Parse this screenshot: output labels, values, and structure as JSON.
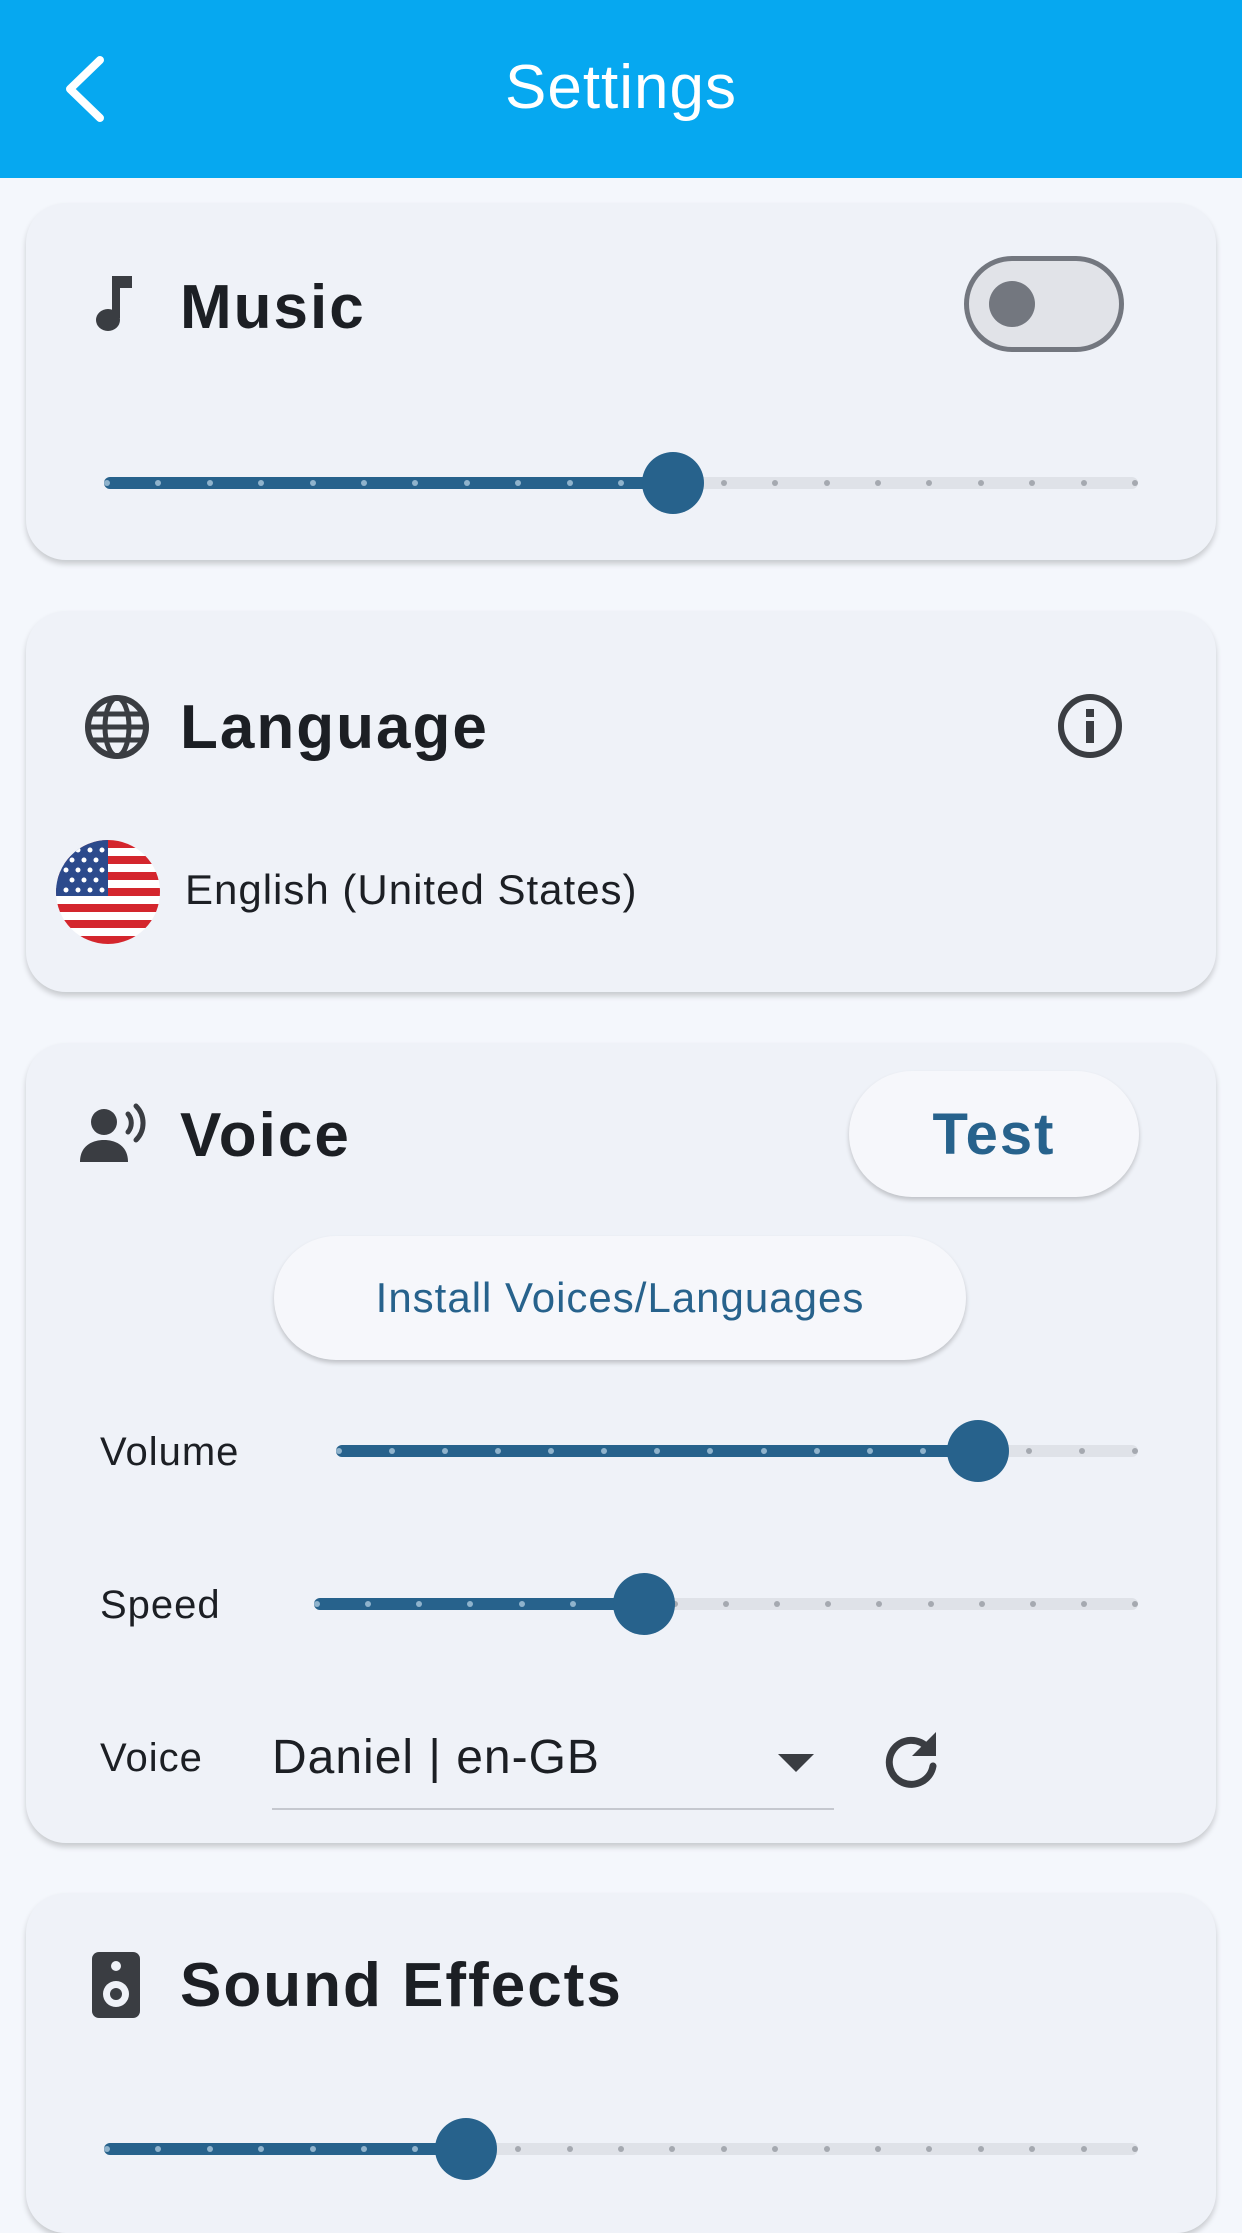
{
  "app_bar": {
    "title": "Settings",
    "back_icon": "chevron-left-icon"
  },
  "music": {
    "title": "Music",
    "icon": "music-note-icon",
    "toggle_on": false,
    "level": 0.55
  },
  "language": {
    "title": "Language",
    "icon": "globe-icon",
    "info_icon": "info-icon",
    "flag_icon": "us-flag-icon",
    "selected": "English (United States)"
  },
  "voice": {
    "title": "Voice",
    "icon": "speaking-person-icon",
    "test_label": "Test",
    "install_label": "Install Voices/Languages",
    "volume_label": "Volume",
    "volume_level": 0.8,
    "speed_label": "Speed",
    "speed_level": 0.4,
    "voice_label": "Voice",
    "voice_value": "Daniel | en-GB",
    "refresh_icon": "refresh-icon"
  },
  "sound_effects": {
    "title": "Sound Effects",
    "icon": "speaker-icon",
    "level": 0.35
  },
  "colors": {
    "app_bar": "#06a8f0",
    "accent": "#27628c",
    "card": "#eff2f8",
    "background": "#f4f7fc"
  }
}
